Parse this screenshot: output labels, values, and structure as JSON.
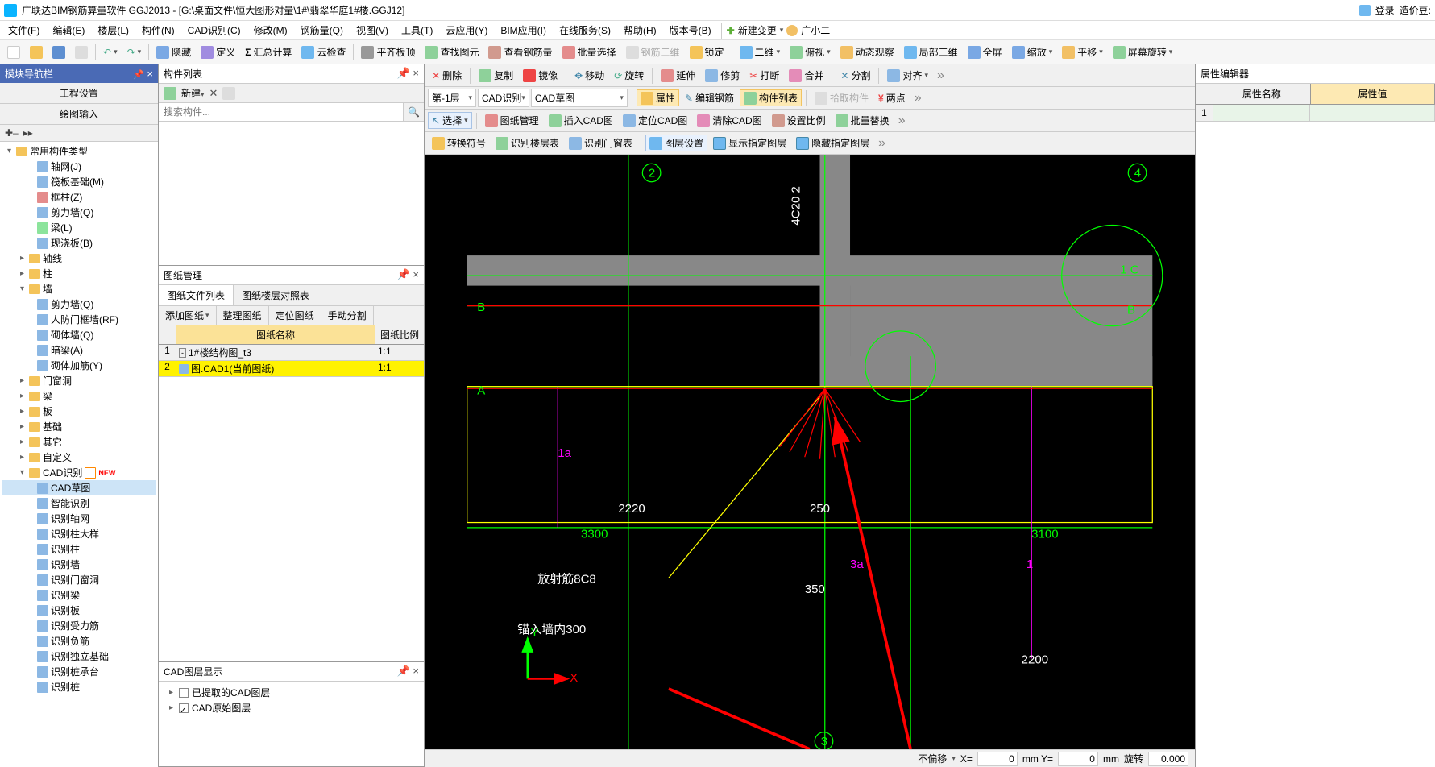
{
  "title": "广联达BIM钢筋算量软件 GGJ2013 - [G:\\桌面文件\\恒大图形对量\\1#\\翡翠华庭1#楼.GGJ12]",
  "login_label": "登录",
  "reward_label": "造价豆:",
  "menu": [
    "文件(F)",
    "编辑(E)",
    "楼层(L)",
    "构件(N)",
    "CAD识别(C)",
    "修改(M)",
    "钢筋量(Q)",
    "视图(V)",
    "工具(T)",
    "云应用(Y)",
    "BIM应用(I)",
    "在线服务(S)",
    "帮助(H)",
    "版本号(B)"
  ],
  "new_change": "新建变更",
  "user_name": "广小二",
  "toolbar1": {
    "hide": "隐藏",
    "define": "定义",
    "sum": "汇总计算",
    "cloud": "云检查",
    "align_top": "平齐板顶",
    "find_elem": "查找图元",
    "view_rebar": "查看钢筋量",
    "batch_sel": "批量选择",
    "rebar_3d": "钢筋三维",
    "lock": "锁定",
    "two_d": "二维",
    "bird": "俯视",
    "dyn": "动态观察",
    "local_3d": "局部三维",
    "full": "全屏",
    "zoom": "缩放",
    "pan": "平移",
    "rotate_screen": "屏幕旋转"
  },
  "left": {
    "header": "模块导航栏",
    "tab1": "工程设置",
    "tab2": "绘图输入",
    "tree": {
      "root": "常用构件类型",
      "axis": "轴网(J)",
      "raft": "筏板基础(M)",
      "frame_col": "框柱(Z)",
      "shear_wall": "剪力墙(Q)",
      "beam": "梁(L)",
      "slab_cast": "现浇板(B)",
      "axis_line": "轴线",
      "column": "柱",
      "wall": "墙",
      "shear_wall_q": "剪力墙(Q)",
      "rf_frame": "人防门框墙(RF)",
      "masonry": "砌体墙(Q)",
      "dark_beam": "暗梁(A)",
      "masonry_rebar": "砌体加筋(Y)",
      "door_win": "门窗洞",
      "beam2": "梁",
      "plate": "板",
      "foundation": "基础",
      "other": "其它",
      "custom": "自定义",
      "cad_rec": "CAD识别",
      "cad_draft": "CAD草图",
      "smart_rec": "智能识别",
      "rec_axis": "识别轴网",
      "rec_col_det": "识别柱大样",
      "rec_col": "识别柱",
      "rec_wall": "识别墙",
      "rec_door": "识别门窗洞",
      "rec_beam": "识别梁",
      "rec_plate": "识别板",
      "rec_tension": "识别受力筋",
      "rec_neg": "识别负筋",
      "rec_indep": "识别独立基础",
      "rec_pile_cap": "识别桩承台",
      "rec_pile": "识别桩"
    }
  },
  "comp_list": {
    "header": "构件列表",
    "new": "新建",
    "search_ph": "搜索构件..."
  },
  "draw_mgr": {
    "header": "图纸管理",
    "tab1": "图纸文件列表",
    "tab2": "图纸楼层对照表",
    "add": "添加图纸",
    "clean": "整理图纸",
    "locate": "定位图纸",
    "manual": "手动分割",
    "col_name": "图纸名称",
    "col_ratio": "图纸比例",
    "row1_name": "1#楼结构图_t3",
    "row1_ratio": "1:1",
    "row2_name": "图.CAD1(当前图纸)",
    "row2_ratio": "1:1"
  },
  "cad_layer": {
    "header": "CAD图层显示",
    "extracted": "已提取的CAD图层",
    "original": "CAD原始图层"
  },
  "canvas_tb": {
    "delete": "删除",
    "copy": "复制",
    "mirror": "镜像",
    "move": "移动",
    "rotate": "旋转",
    "extend": "延伸",
    "trim": "修剪",
    "break": "打断",
    "merge": "合并",
    "split": "分割",
    "align": "对齐",
    "floor_sel": "第-1层",
    "cad_rec": "CAD识别",
    "cad_draft": "CAD草图",
    "prop": "属性",
    "edit_rebar": "编辑钢筋",
    "comp_list": "构件列表",
    "pick": "拾取构件",
    "two_pt": "两点",
    "select": "选择",
    "draw_mgr": "图纸管理",
    "insert_cad": "插入CAD图",
    "locate_cad": "定位CAD图",
    "clear_cad": "清除CAD图",
    "set_scale": "设置比例",
    "batch_rep": "批量替换",
    "conv_sym": "转换符号",
    "rec_floor": "识别楼层表",
    "rec_door_tbl": "识别门窗表",
    "layer_set": "图层设置",
    "show_layer": "显示指定图层",
    "hide_layer": "隐藏指定图层"
  },
  "prop_panel": {
    "header": "属性编辑器",
    "col_name": "属性名称",
    "col_val": "属性值"
  },
  "status": {
    "no_offset": "不偏移",
    "x": "X=",
    "y": "mm Y=",
    "mm": "mm",
    "rotate": "旋转",
    "val0": "0",
    "val_deg": "0.000"
  },
  "canvas_labels": {
    "dim_2220": "2220",
    "dim_250": "250",
    "dim_3300": "3300",
    "dim_3100": "3100",
    "dim_350": "350",
    "dim_2200": "2200",
    "dim_4c20": "4C20 2",
    "text_rad": "放射筋8C8",
    "text_anchor": "锚入墙内300",
    "mark_1a": "1a",
    "mark_3a": "3a",
    "mark_1": "1",
    "mark_2": "2",
    "mark_3": "3",
    "mark_4": "4",
    "mark_a": "A",
    "mark_b": "B",
    "mark_1c": "1 C",
    "mark_b2": "B"
  }
}
